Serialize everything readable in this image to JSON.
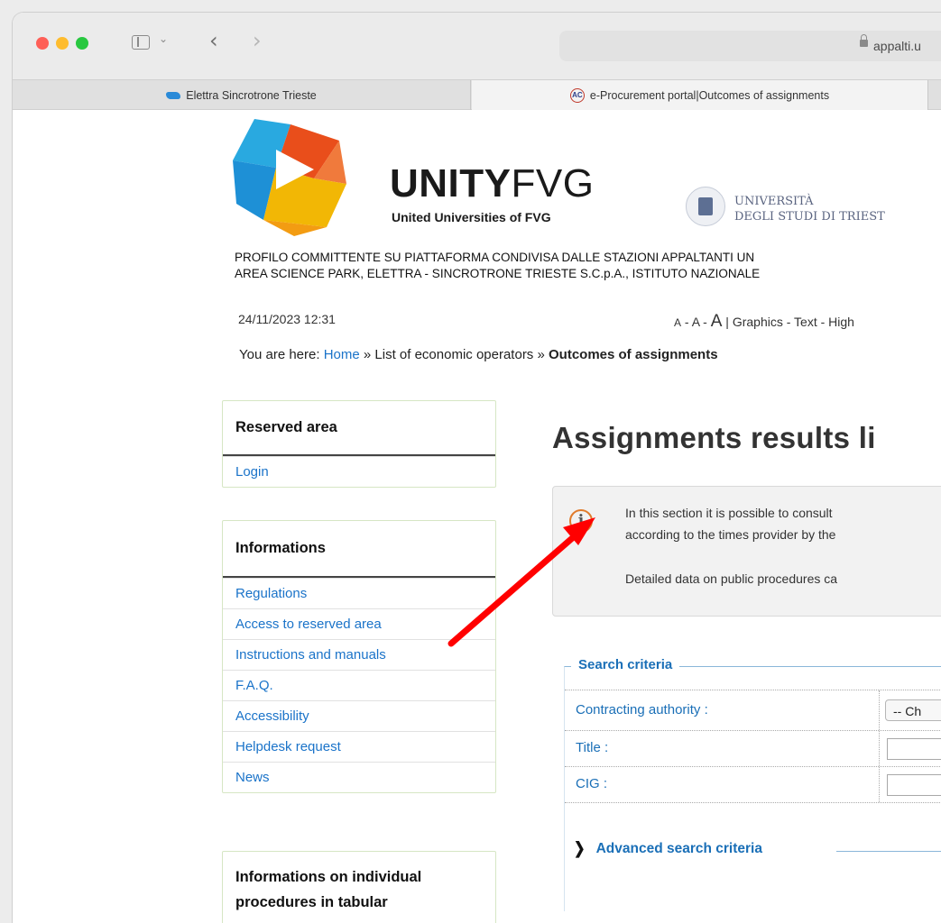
{
  "browser": {
    "url": "appalti.u",
    "tabs": [
      {
        "label": "Elettra Sincrotrone Trieste",
        "active": false
      },
      {
        "label": "e-Procurement portal|Outcomes of assignments",
        "active": true
      }
    ]
  },
  "header": {
    "logo_main": "UNITY",
    "logo_fvg": "FVG",
    "logo_sub": "United Universities of FVG",
    "university_line1": "UNIVERSITÀ",
    "university_line2": "DEGLI STUDI DI TRIEST",
    "profile_line1": "PROFILO COMMITTENTE SU PIATTAFORMA CONDIVISA DALLE STAZIONI APPALTANTI UN",
    "profile_line2": "AREA SCIENCE PARK, ELETTRA - SINCROTRONE TRIESTE S.C.p.A., ISTITUTO NAZIONALE",
    "datetime": "24/11/2023 12:31",
    "accessibility": {
      "a_small": "A",
      "sep1": " - ",
      "a_mid": "A",
      "sep2": " - ",
      "a_big": "A",
      "rest": " | Graphics - Text - High"
    }
  },
  "breadcrumb": {
    "prefix": "You are here: ",
    "home": "Home",
    "sep1": " » ",
    "middle": "List of economic operators",
    "sep2": " » ",
    "current": "Outcomes of assignments"
  },
  "sidebar": {
    "reserved_title": "Reserved area",
    "reserved_items": [
      "Login"
    ],
    "info_title": "Informations",
    "info_items": [
      "Regulations",
      "Access to reserved area",
      "Instructions and manuals",
      "F.A.Q.",
      "Accessibility",
      "Helpdesk request",
      "News"
    ],
    "tabular_title_line1": "Informations on individual",
    "tabular_title_line2": "procedures in tabular"
  },
  "main": {
    "title": "Assignments results li",
    "info_line1": "In this section it is possible to consult",
    "info_line2": "according to the times provider by the",
    "info_line3": "Detailed data on public procedures ca",
    "search": {
      "legend": "Search criteria",
      "contracting_label": "Contracting authority :",
      "contracting_value": "-- Ch",
      "title_label": "Title :",
      "cig_label": "CIG :",
      "advanced_label": "Advanced search criteria"
    }
  },
  "colors": {
    "link": "#1a73c9",
    "fieldset": "#1a6fb7",
    "arrow": "#ff0000",
    "info_icon": "#e07b2c"
  }
}
